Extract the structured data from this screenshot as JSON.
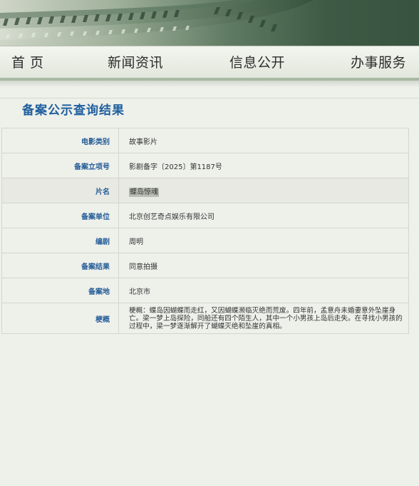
{
  "nav": {
    "items": [
      {
        "label": "首 页"
      },
      {
        "label": "新闻资讯"
      },
      {
        "label": "信息公开"
      },
      {
        "label": "办事服务"
      }
    ]
  },
  "page": {
    "title": "备案公示查询结果"
  },
  "record": {
    "rows": [
      {
        "label": "电影类别",
        "value": "故事影片"
      },
      {
        "label": "备案立项号",
        "value": "影剧备字〔2025〕第1187号"
      },
      {
        "label": "片名",
        "value": "蝶岛惊魂"
      },
      {
        "label": "备案单位",
        "value": "北京创艺奇点娱乐有限公司"
      },
      {
        "label": "编剧",
        "value": "周明"
      },
      {
        "label": "备案结果",
        "value": "同意拍摄"
      },
      {
        "label": "备案地",
        "value": "北京市"
      },
      {
        "label": "梗概",
        "value": "梗概：蝶岛因蝴蝶而走红，又因蝴蝶濒临灭绝而荒废。四年前，孟意舟未婚妻意外坠崖身亡。梁一梦上岛探险，同船还有四个陌生人，其中一个小男孩上岛后走失。在寻找小男孩的过程中，梁一梦逐渐解开了蝴蝶灭绝和坠崖的真相。"
      }
    ]
  },
  "colors": {
    "label_blue": "#245d97",
    "title_blue": "#1f5f9e",
    "banner_green": "#3e5a45"
  }
}
